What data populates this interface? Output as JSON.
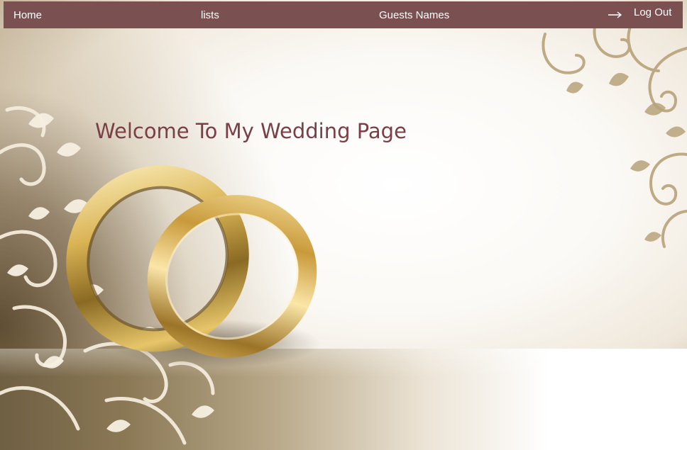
{
  "nav": {
    "home_label": "Home",
    "lists_label": "lists",
    "guests_label": "Guests Names",
    "logout_label": "Log Out",
    "logout_icon": "right-arrow-icon"
  },
  "main": {
    "title": "Welcome To My Wedding Page"
  },
  "colors": {
    "navbar": "#7a5050",
    "title": "#7a3f46",
    "gold": "#c9a648"
  }
}
